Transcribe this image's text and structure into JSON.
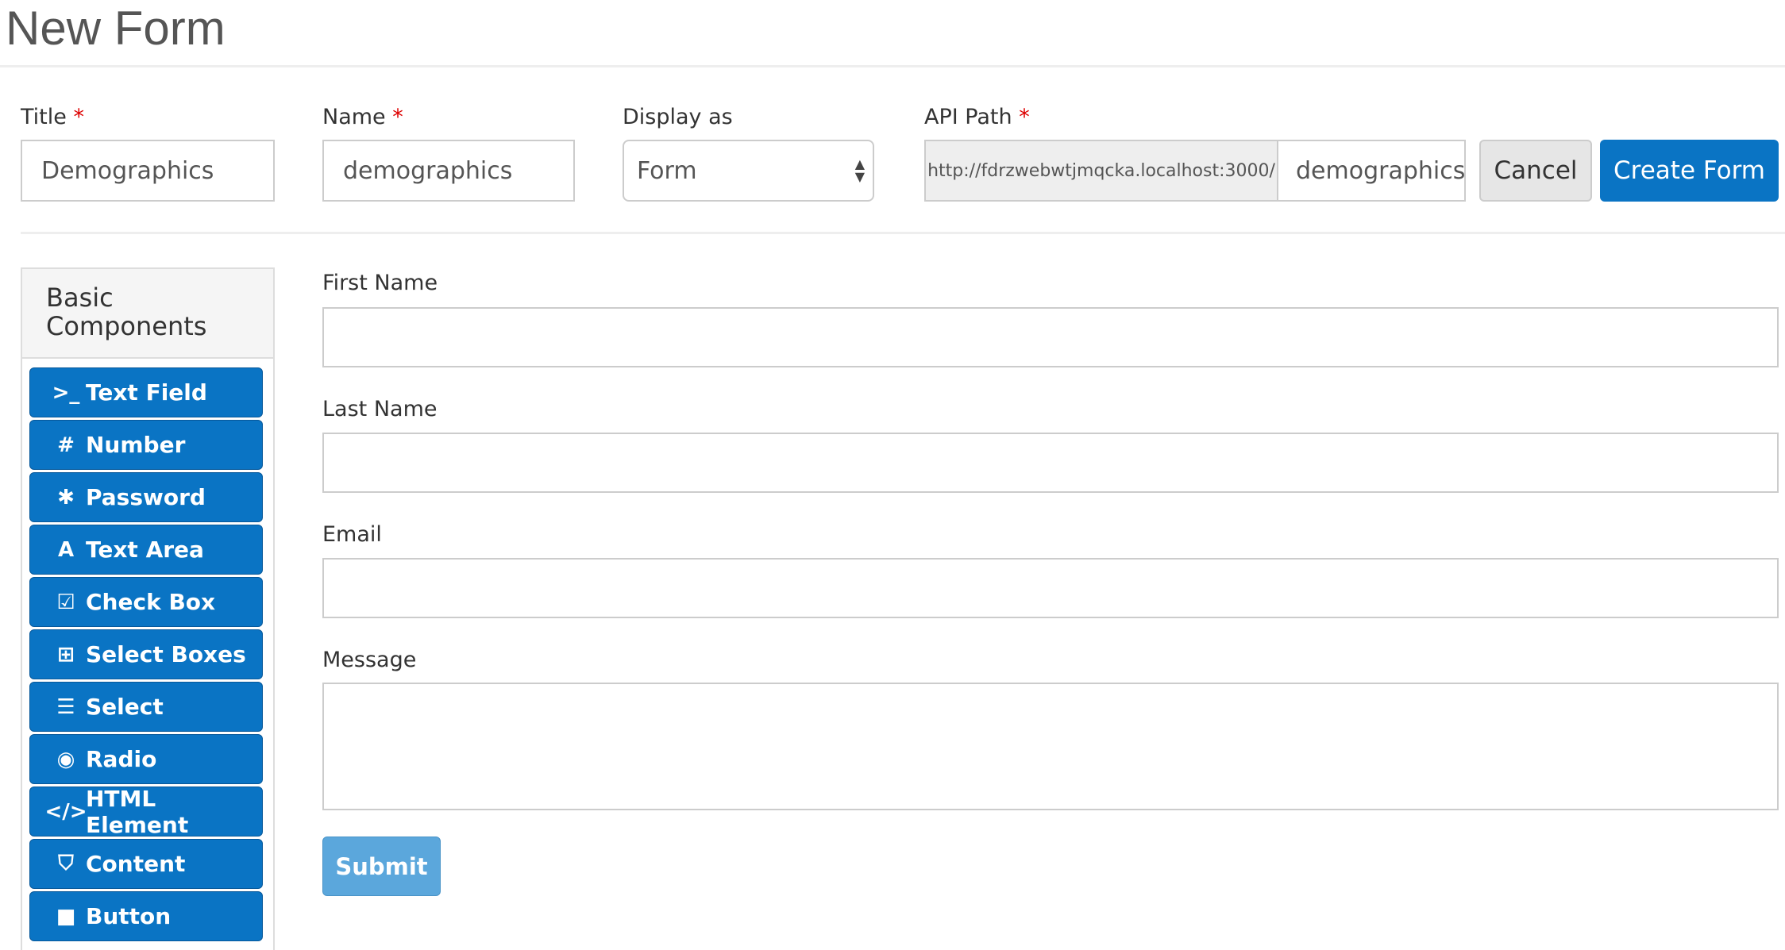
{
  "page": {
    "title": "New Form"
  },
  "settings": {
    "title": {
      "label": "Title",
      "required": "*",
      "value": "Demographics"
    },
    "name": {
      "label": "Name",
      "required": "*",
      "value": "demographics"
    },
    "display": {
      "label": "Display as",
      "value": "Form"
    },
    "api": {
      "label": "API Path",
      "required": "*",
      "prefix": "http://fdrzwebwtjmqcka.localhost:3000/",
      "value": "demographics"
    },
    "cancel": "Cancel",
    "create": "Create Form"
  },
  "sidebar": {
    "title": "Basic Components",
    "items": [
      {
        "label": "Text Field",
        "icon": "terminal-icon",
        "glyph": ">_"
      },
      {
        "label": "Number",
        "icon": "hashtag-icon",
        "glyph": "#"
      },
      {
        "label": "Password",
        "icon": "asterisk-icon",
        "glyph": "✱"
      },
      {
        "label": "Text Area",
        "icon": "font-icon",
        "glyph": "A"
      },
      {
        "label": "Check Box",
        "icon": "check-square-icon",
        "glyph": "☑"
      },
      {
        "label": "Select Boxes",
        "icon": "plus-square-icon",
        "glyph": "⊞"
      },
      {
        "label": "Select",
        "icon": "list-icon",
        "glyph": "☰"
      },
      {
        "label": "Radio",
        "icon": "dot-circle-icon",
        "glyph": "◉"
      },
      {
        "label": "HTML Element",
        "icon": "code-icon",
        "glyph": "</>"
      },
      {
        "label": "Content",
        "icon": "html5-icon",
        "glyph": "⛉"
      },
      {
        "label": "Button",
        "icon": "stop-icon",
        "glyph": "■"
      }
    ]
  },
  "form": {
    "fields": [
      {
        "label": "First Name",
        "value": ""
      },
      {
        "label": "Last Name",
        "value": ""
      },
      {
        "label": "Email",
        "value": ""
      },
      {
        "label": "Message",
        "value": ""
      }
    ],
    "submit": "Submit"
  },
  "colors": {
    "primary": "#0a74c4",
    "submit": "#5ba7dc",
    "required": "#dd0000"
  }
}
